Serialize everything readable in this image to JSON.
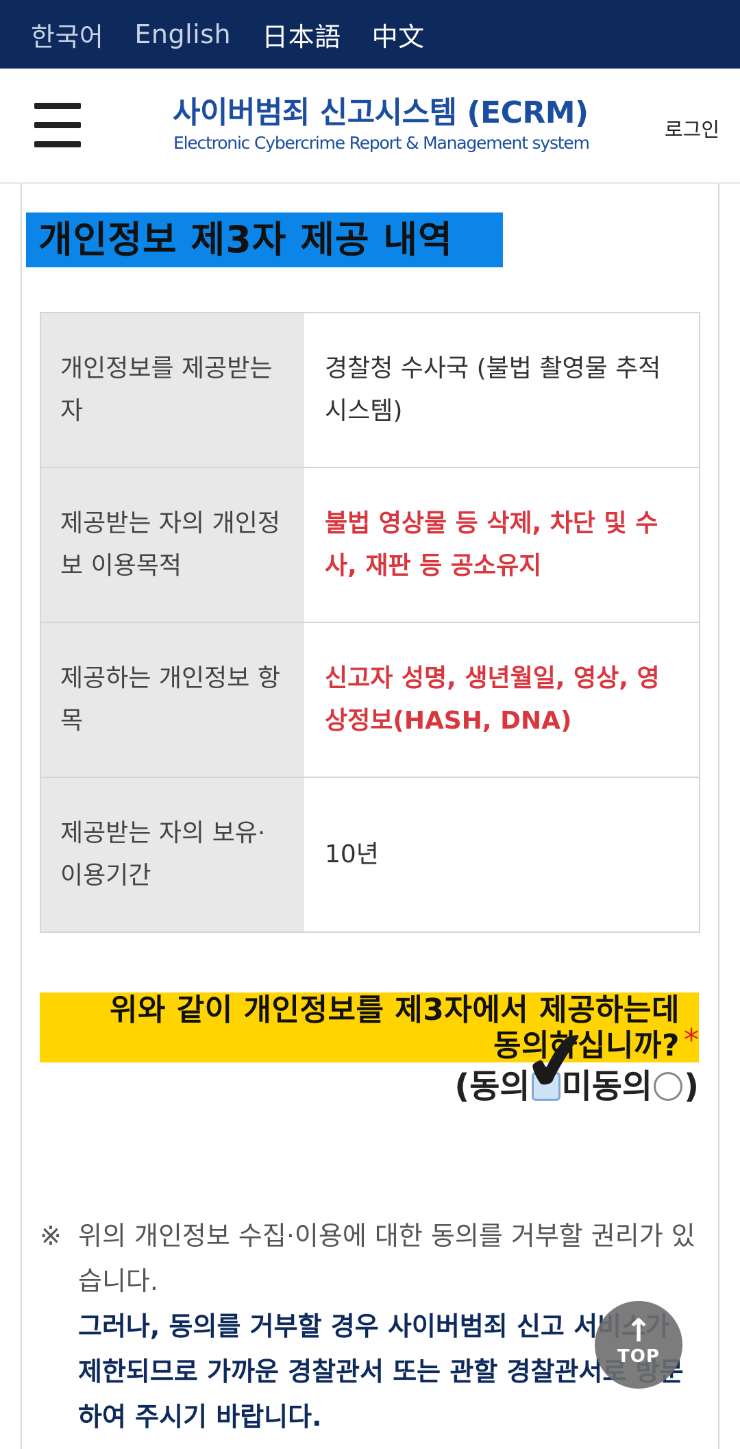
{
  "languages": [
    {
      "label": "한국어"
    },
    {
      "label": "English"
    },
    {
      "label": "日本語"
    },
    {
      "label": "中文"
    }
  ],
  "header": {
    "title": "사이버범죄 신고시스템 (ECRM)",
    "subtitle": "Electronic Cybercrime Report & Management system",
    "login_label": "로그인",
    "menu_icon": "hamburger-menu-icon"
  },
  "section": {
    "title": "개인정보 제3자 제공 내역"
  },
  "table": {
    "rows": [
      {
        "label": "개인정보를 제공받는 자",
        "value": "경찰청 수사국 (불법 촬영물 추적 시스템)",
        "highlight": false
      },
      {
        "label": "제공받는 자의 개인정보 이용목적",
        "value": "불법 영상물 등 삭제, 차단 및 수사, 재판 등 공소유지",
        "highlight": true
      },
      {
        "label": "제공하는 개인정보 항목",
        "value": "신고자 성명, 생년월일, 영상, 영상정보(HASH, DNA)",
        "highlight": true
      },
      {
        "label": "제공받는 자의 보유·이용기간",
        "value": "10년",
        "highlight": false
      }
    ]
  },
  "consent": {
    "question_line1": "위와 같이 개인정보를 제3자에서 제공하는데",
    "question_line2": "동의하십니까?",
    "required_mark": "*",
    "open_paren": "(",
    "agree_label": "동의",
    "disagree_label": "미동의",
    "close_paren": ")",
    "checkmark_glyph": "✔"
  },
  "notice": {
    "mark": "※",
    "text": "위의 개인정보 수집·이용에 대한 동의를 거부할 권리가 있습니다.",
    "strong_text": "그러나, 동의를 거부할 경우 사이버범죄 신고 서비스가 제한되므로 가까운 경찰관서 또는 관할 경찰관서로 방문하여 주시기 바랍니다."
  },
  "top_button": {
    "arrow": "↑",
    "label": "TOP"
  },
  "colors": {
    "lang_bar": "#0e2a5c",
    "brand_blue": "#1b4da0",
    "section_title_bg": "#0b86e8",
    "highlight_red": "#d9363e",
    "question_bg": "#ffd400"
  }
}
